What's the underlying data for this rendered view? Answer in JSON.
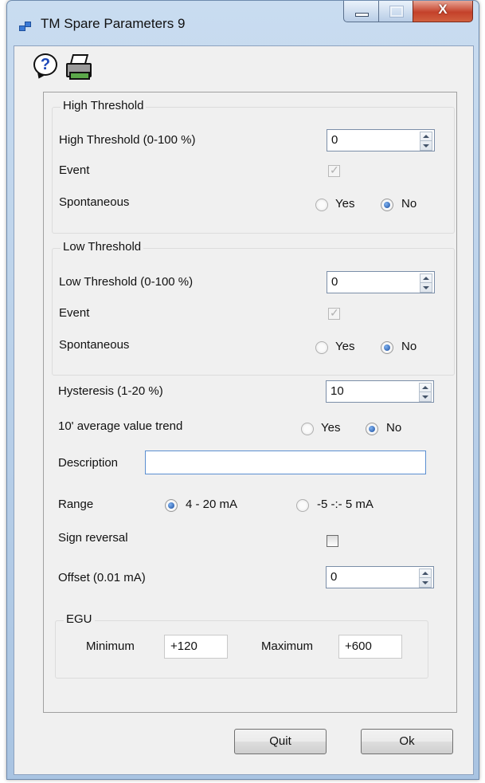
{
  "window": {
    "title": "TM Spare Parameters 9",
    "close_glyph": "X",
    "icons": {
      "app": "app-window-icon",
      "help": "help-icon",
      "print": "printer-icon"
    }
  },
  "help_glyph": "?",
  "high_threshold": {
    "group_title": "High Threshold",
    "field_label": "High Threshold (0-100 %)",
    "value": "0",
    "event_label": "Event",
    "event_checked": true,
    "spontaneous_label": "Spontaneous",
    "yes_label": "Yes",
    "no_label": "No",
    "selected": "No"
  },
  "low_threshold": {
    "group_title": "Low Threshold",
    "field_label": "Low Threshold (0-100 %)",
    "value": "0",
    "event_label": "Event",
    "event_checked": true,
    "spontaneous_label": "Spontaneous",
    "yes_label": "Yes",
    "no_label": "No",
    "selected": "No"
  },
  "hysteresis": {
    "label": "Hysteresis (1-20 %)",
    "value": "10"
  },
  "average_trend": {
    "label": "10' average value trend",
    "yes_label": "Yes",
    "no_label": "No",
    "selected": "No"
  },
  "description": {
    "label": "Description",
    "value": ""
  },
  "range": {
    "label": "Range",
    "option1": "4 - 20 mA",
    "option2": "-5 -:- 5 mA",
    "selected": "4 - 20 mA"
  },
  "sign_reversal": {
    "label": "Sign reversal",
    "checked": false
  },
  "offset": {
    "label": "Offset (0.01 mA)",
    "value": "0"
  },
  "egu": {
    "group_title": "EGU",
    "min_label": "Minimum",
    "min_value": "+120",
    "max_label": "Maximum",
    "max_value": "+600"
  },
  "buttons": {
    "quit": "Quit",
    "ok": "Ok"
  },
  "colors": {
    "selected_radio": "#1b4d9e",
    "close_button": "#c4412a",
    "titlebar": "#b9d1ea"
  }
}
